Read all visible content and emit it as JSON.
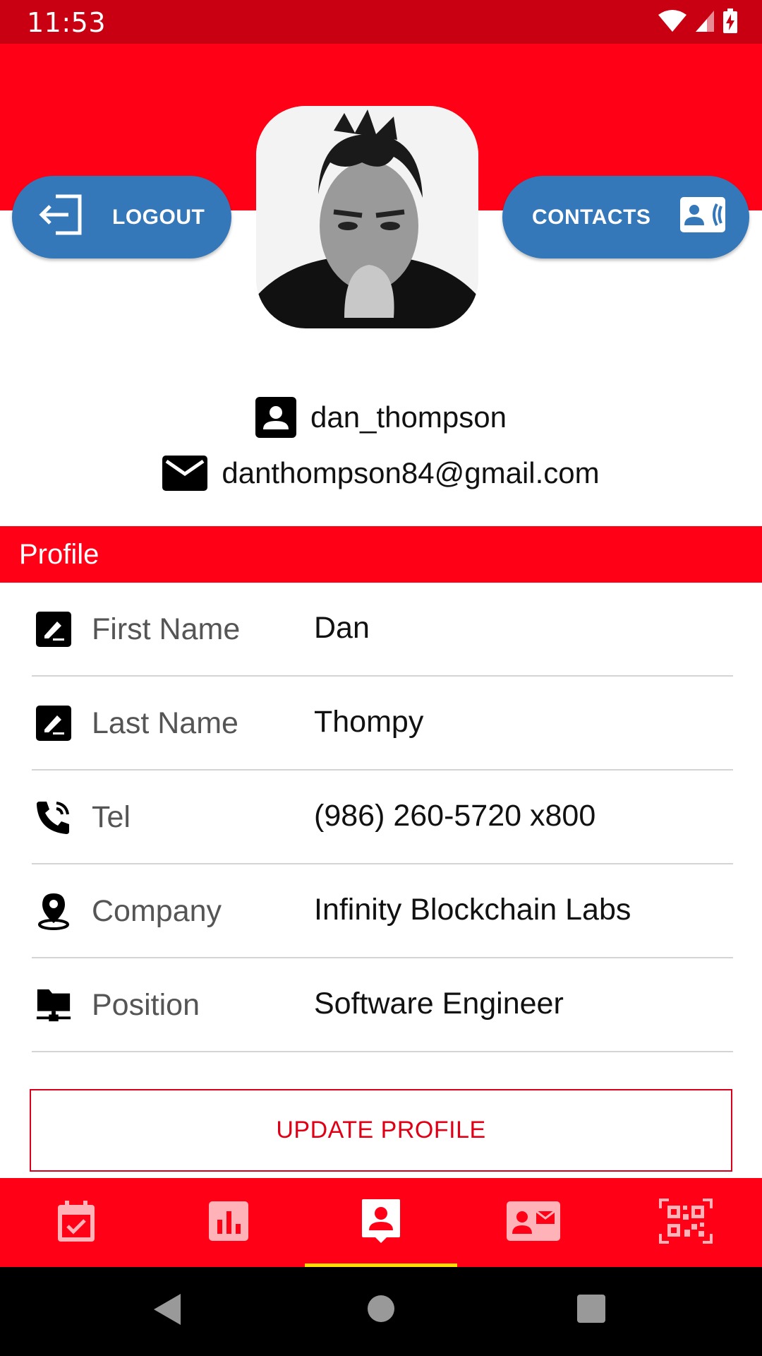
{
  "status": {
    "time": "11:53"
  },
  "header": {
    "logout_label": "LOGOUT",
    "contacts_label": "CONTACTS"
  },
  "user": {
    "username": "dan_thompson",
    "email": "danthompson84@gmail.com"
  },
  "section": {
    "title": "Profile"
  },
  "fields": [
    {
      "label": "First Name",
      "value": "Dan",
      "icon": "edit-box-icon"
    },
    {
      "label": "Last Name",
      "value": "Thompy",
      "icon": "edit-box-icon"
    },
    {
      "label": "Tel",
      "value": "(986) 260-5720 x800",
      "icon": "phone-icon"
    },
    {
      "label": "Company",
      "value": "Infinity Blockchain Labs",
      "icon": "location-pin-icon"
    },
    {
      "label": "Position",
      "value": "Software Engineer",
      "icon": "folder-network-icon"
    }
  ],
  "update_label": "UPDATE PROFILE",
  "bottom_nav": [
    {
      "icon": "calendar-check-icon",
      "active": false
    },
    {
      "icon": "bar-chart-icon",
      "active": false
    },
    {
      "icon": "profile-badge-icon",
      "active": true
    },
    {
      "icon": "contact-card-icon",
      "active": false
    },
    {
      "icon": "qr-code-icon",
      "active": false
    }
  ],
  "colors": {
    "primary_red": "#ff0016",
    "status_red": "#c90012",
    "button_blue": "#3478b9",
    "active_indicator": "#ffe000"
  }
}
